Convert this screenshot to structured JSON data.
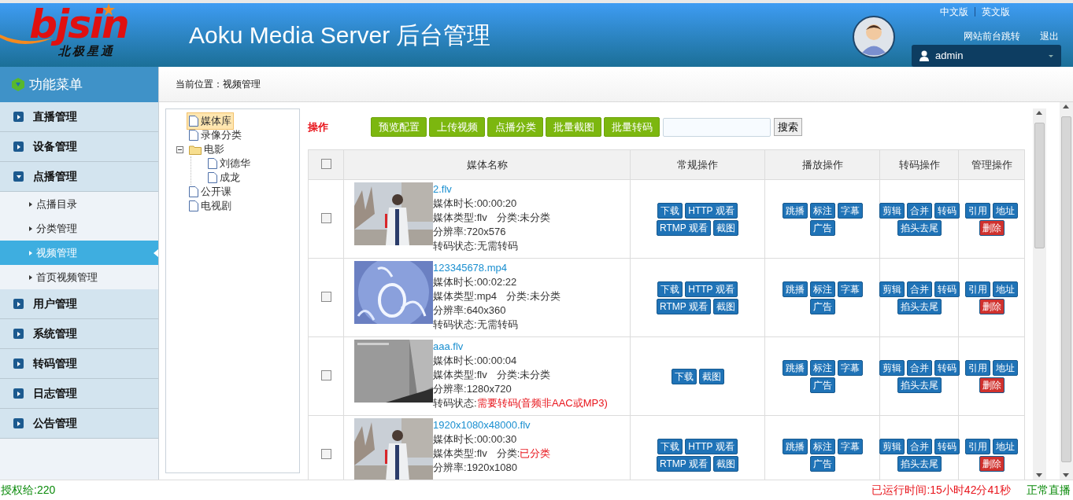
{
  "header": {
    "logo": {
      "text": "bjsin",
      "subtitle": "北极星通"
    },
    "title": "Aoku Media Server 后台管理",
    "languages": [
      {
        "label": "中文版"
      },
      {
        "label": "英文版"
      }
    ],
    "links": [
      {
        "label": "网站前台跳转"
      },
      {
        "label": "退出"
      }
    ],
    "user": "admin"
  },
  "sidebar": {
    "title": "功能菜单",
    "items": [
      {
        "label": "直播管理",
        "expanded": false
      },
      {
        "label": "设备管理",
        "expanded": false
      },
      {
        "label": "点播管理",
        "expanded": true,
        "children": [
          {
            "label": "点播目录",
            "selected": false
          },
          {
            "label": "分类管理",
            "selected": false
          },
          {
            "label": "视频管理",
            "selected": true
          },
          {
            "label": "首页视频管理",
            "selected": false
          }
        ]
      },
      {
        "label": "用户管理",
        "expanded": false
      },
      {
        "label": "系统管理",
        "expanded": false
      },
      {
        "label": "转码管理",
        "expanded": false
      },
      {
        "label": "日志管理",
        "expanded": false
      },
      {
        "label": "公告管理",
        "expanded": false
      }
    ]
  },
  "breadcrumb": "当前位置：视频管理",
  "tree": [
    {
      "label": "媒体库",
      "selected": true
    },
    {
      "label": "录像分类",
      "selected": false
    },
    {
      "label": "电影",
      "selected": false,
      "expanded": true,
      "children": [
        {
          "label": "刘德华",
          "selected": false
        },
        {
          "label": "成龙",
          "selected": false
        }
      ]
    },
    {
      "label": "公开课",
      "selected": false
    },
    {
      "label": "电视剧",
      "selected": false
    }
  ],
  "toolbar": {
    "label": "操作",
    "buttons": [
      "预览配置",
      "上传视频",
      "点播分类",
      "批量截图",
      "批量转码"
    ],
    "search_button": "搜索"
  },
  "table": {
    "select_all": false,
    "columns": [
      "媒体名称",
      "常规操作",
      "播放操作",
      "转码操作",
      "管理操作"
    ],
    "rows": [
      {
        "checked": false,
        "name": "2.flv",
        "lines": [
          [
            {
              "label": "媒体时长:",
              "value": "00:00:20",
              "alert": false
            }
          ],
          [
            {
              "label": "媒体类型:",
              "value": "flv",
              "alert": false
            },
            {
              "label": "分类:",
              "value": "未分类",
              "alert": false
            }
          ],
          [
            {
              "label": "分辨率:",
              "value": "720x576",
              "alert": false
            }
          ],
          [
            {
              "label": "转码状态:",
              "value": "无需转码",
              "alert": false
            }
          ]
        ],
        "general": [
          [
            "下载",
            "HTTP 观看"
          ],
          [
            "RTMP 观看",
            "截图"
          ]
        ],
        "play": [
          [
            "跳播",
            "标注",
            "字幕"
          ],
          [
            "广告"
          ]
        ],
        "transcode": [
          [
            "剪辑",
            "合并",
            "转码"
          ],
          [
            "掐头去尾"
          ]
        ],
        "manage": [
          [
            {
              "label": "引用",
              "kind": "normal"
            },
            {
              "label": "地址",
              "kind": "normal"
            }
          ],
          [
            {
              "label": "删除",
              "kind": "danger"
            }
          ]
        ]
      },
      {
        "checked": false,
        "name": "123345678.mp4",
        "lines": [
          [
            {
              "label": "媒体时长:",
              "value": "00:02:22",
              "alert": false
            }
          ],
          [
            {
              "label": "媒体类型:",
              "value": "mp4",
              "alert": false
            },
            {
              "label": "分类:",
              "value": "未分类",
              "alert": false
            }
          ],
          [
            {
              "label": "分辨率:",
              "value": "640x360",
              "alert": false
            }
          ],
          [
            {
              "label": "转码状态:",
              "value": "无需转码",
              "alert": false
            }
          ]
        ],
        "general": [
          [
            "下载",
            "HTTP 观看"
          ],
          [
            "RTMP 观看",
            "截图"
          ]
        ],
        "play": [
          [
            "跳播",
            "标注",
            "字幕"
          ],
          [
            "广告"
          ]
        ],
        "transcode": [
          [
            "剪辑",
            "合并",
            "转码"
          ],
          [
            "掐头去尾"
          ]
        ],
        "manage": [
          [
            {
              "label": "引用",
              "kind": "normal"
            },
            {
              "label": "地址",
              "kind": "normal"
            }
          ],
          [
            {
              "label": "删除",
              "kind": "danger"
            }
          ]
        ]
      },
      {
        "checked": false,
        "name": "aaa.flv",
        "lines": [
          [
            {
              "label": "媒体时长:",
              "value": "00:00:04",
              "alert": false
            }
          ],
          [
            {
              "label": "媒体类型:",
              "value": "flv",
              "alert": false
            },
            {
              "label": "分类:",
              "value": "未分类",
              "alert": false
            }
          ],
          [
            {
              "label": "分辨率:",
              "value": "1280x720",
              "alert": false
            }
          ],
          [
            {
              "label": "转码状态:",
              "value": "需要转码(音频非AAC或MP3)",
              "alert": true
            }
          ]
        ],
        "general": [
          [
            "下载",
            "截图"
          ]
        ],
        "play": [
          [
            "跳播",
            "标注",
            "字幕"
          ],
          [
            "广告"
          ]
        ],
        "transcode": [
          [
            "剪辑",
            "合并",
            "转码"
          ],
          [
            "掐头去尾"
          ]
        ],
        "manage": [
          [
            {
              "label": "引用",
              "kind": "normal"
            },
            {
              "label": "地址",
              "kind": "normal"
            }
          ],
          [
            {
              "label": "删除",
              "kind": "danger"
            }
          ]
        ]
      },
      {
        "checked": false,
        "name": "1920x1080x48000.flv",
        "lines": [
          [
            {
              "label": "媒体时长:",
              "value": "00:00:30",
              "alert": false
            }
          ],
          [
            {
              "label": "媒体类型:",
              "value": "flv",
              "alert": false
            },
            {
              "label": "分类:",
              "value": "已分类",
              "alert": true
            }
          ],
          [
            {
              "label": "分辨率:",
              "value": "1920x1080",
              "alert": false
            }
          ]
        ],
        "general": [
          [
            "下载",
            "HTTP 观看"
          ],
          [
            "RTMP 观看",
            "截图"
          ]
        ],
        "play": [
          [
            "跳播",
            "标注",
            "字幕"
          ],
          [
            "广告"
          ]
        ],
        "transcode": [
          [
            "剪辑",
            "合并",
            "转码"
          ],
          [
            "掐头去尾"
          ]
        ],
        "manage": [
          [
            {
              "label": "引用",
              "kind": "normal"
            },
            {
              "label": "地址",
              "kind": "normal"
            }
          ],
          [
            {
              "label": "删除",
              "kind": "danger"
            }
          ]
        ]
      }
    ]
  },
  "status_bar": {
    "license": "授权给:220",
    "uptime": "已运行时间:15小时42分41秒",
    "status": "正常直播"
  }
}
